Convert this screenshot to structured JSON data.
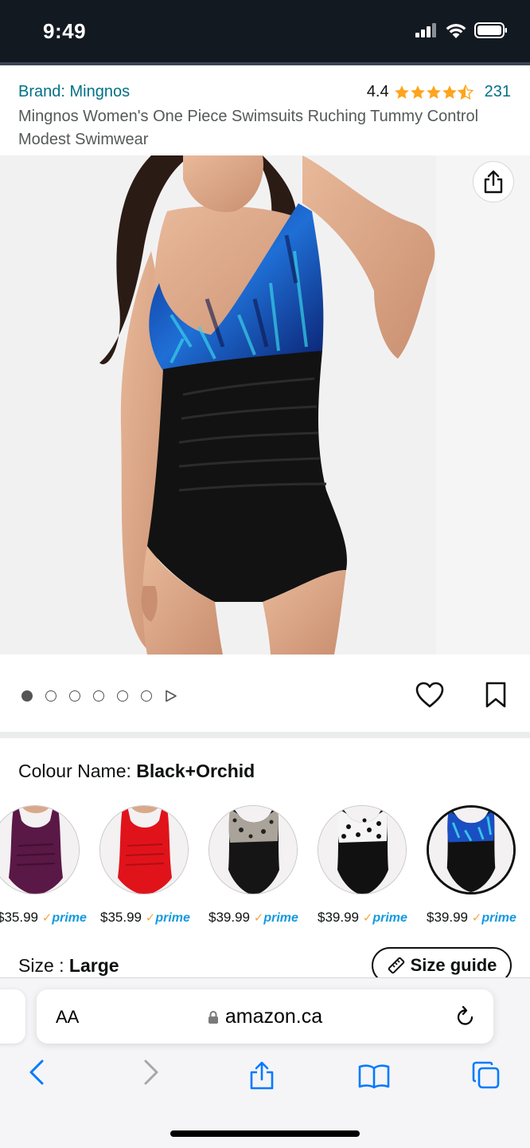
{
  "status_bar": {
    "time": "9:49"
  },
  "header": {
    "brand": "Brand: Mingnos",
    "rating_value": "4.4",
    "rating_stars": 4.4,
    "rating_count": "231",
    "title": "Mingnos Women's One Piece Swimsuits Ruching Tummy Control Modest Swimwear"
  },
  "gallery": {
    "image_count": 6,
    "current_index": 1,
    "has_video": true
  },
  "colour": {
    "label": "Colour Name:",
    "selected": "Black+Orchid",
    "options": [
      {
        "name": "purple",
        "price": "$35.99",
        "prime": "prime",
        "selected": false
      },
      {
        "name": "red",
        "price": "$35.99",
        "prime": "prime",
        "selected": false
      },
      {
        "name": "leopard",
        "price": "$39.99",
        "prime": "prime",
        "selected": false
      },
      {
        "name": "polka-dot",
        "price": "$39.99",
        "prime": "prime",
        "selected": false
      },
      {
        "name": "Black+Orchid",
        "price": "$39.99",
        "prime": "prime",
        "selected": true
      }
    ]
  },
  "size": {
    "label": "Size :",
    "selected": "Large",
    "guide_label": "Size guide"
  },
  "browser": {
    "aa_label": "AA",
    "url": "amazon.ca"
  },
  "colors": {
    "link": "#007185",
    "star": "#ffa41c",
    "prime": "#1399e0",
    "status_bar": "#131921",
    "ios_blue": "#007aff"
  }
}
